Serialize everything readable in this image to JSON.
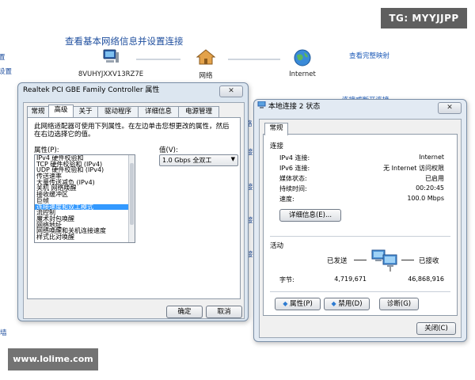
{
  "watermarks": {
    "top_right": "TG: MYYJJPP",
    "bottom_left": "www.lolime.com"
  },
  "background": {
    "title": "查看基本网络信息并设置连接",
    "nodes": [
      {
        "label": "8VUHYJXXV13RZ7E",
        "icon": "computer-icon"
      },
      {
        "label": "网络",
        "icon": "house-icon"
      },
      {
        "label": "Internet",
        "icon": "globe-icon"
      }
    ],
    "link_full_map": "查看完整映射",
    "link_connect": "连接或断开连接",
    "side_fragments": [
      "置",
      "设置",
      "络",
      "接",
      "接",
      "接",
      "接",
      "墙"
    ]
  },
  "properties_dialog": {
    "title": "Realtek PCI GBE Family Controller 属性",
    "close_label": "✕",
    "tabs": [
      "常规",
      "高级",
      "关于",
      "驱动程序",
      "详细信息",
      "电源管理"
    ],
    "active_tab": 1,
    "description": "此网络适配器可使用下列属性。在左边单击您想更改的属性，然后在右边选择它的值。",
    "property_label": "属性(P):",
    "value_label": "值(V):",
    "properties": [
      "IPv4 硬件校验和",
      "TCP 硬件校验和 (IPv4)",
      "UDP 硬件校验和 (IPv4)",
      "传送速率",
      "大量传送减负 (IPv4)",
      "关机 网络唤醒",
      "接收缓冲区",
      "巨帧",
      "连接速度和双工模式",
      "流控制",
      "魔术封包唤醒",
      "网络地址",
      "网络唤醒和关机连接速度",
      "样式比对唤醒"
    ],
    "selected_property": 8,
    "value_selected": "1.0 Gbps 全双工",
    "ok_label": "确定",
    "cancel_label": "取消"
  },
  "status_dialog": {
    "title": "本地连接 2 状态",
    "close_label": "✕",
    "tab": "常规",
    "connection_group": "连接",
    "rows": [
      {
        "label": "IPv4 连接:",
        "value": "Internet"
      },
      {
        "label": "IPv6 连接:",
        "value": "无 Internet 访问权限"
      },
      {
        "label": "媒体状态:",
        "value": "已启用"
      },
      {
        "label": "持续时间:",
        "value": "00:20:45"
      },
      {
        "label": "速度:",
        "value": "100.0 Mbps"
      }
    ],
    "details_label": "详细信息(E)...",
    "activity_group": "活动",
    "sent_label": "已发送",
    "received_label": "已接收",
    "bytes_label": "字节:",
    "bytes_sent": "4,719,671",
    "bytes_received": "46,868,916",
    "properties_btn": "属性(P)",
    "disable_btn": "禁用(D)",
    "diagnose_btn": "诊断(G)",
    "close_btn": "关闭(C)"
  }
}
